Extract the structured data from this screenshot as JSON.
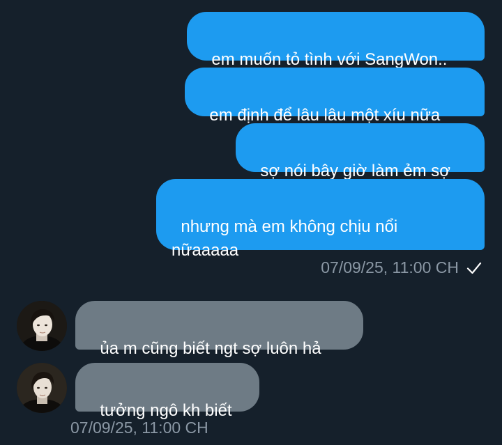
{
  "messages_sent": [
    {
      "text": "em muốn tỏ tình với SangWon.."
    },
    {
      "text": "em định để lâu lâu một xíu nữa"
    },
    {
      "text": "sợ nói bây giờ làm ẻm sợ"
    },
    {
      "text": "nhưng mà em không chịu nổi\nnữaaaaa"
    }
  ],
  "sent_timestamp": "07/09/25, 11:00 CH",
  "sent_status_icon": "checkmark-icon",
  "messages_received": [
    {
      "text": "ủa m cũng biết ngt sợ luôn hả"
    },
    {
      "text": "tưởng ngô kh biết"
    }
  ],
  "received_timestamp": "07/09/25, 11:00 CH",
  "colors": {
    "background": "#15202b",
    "sent_bubble": "#1d9bf0",
    "received_bubble": "#6e7b85",
    "timestamp": "#8b98a5"
  }
}
